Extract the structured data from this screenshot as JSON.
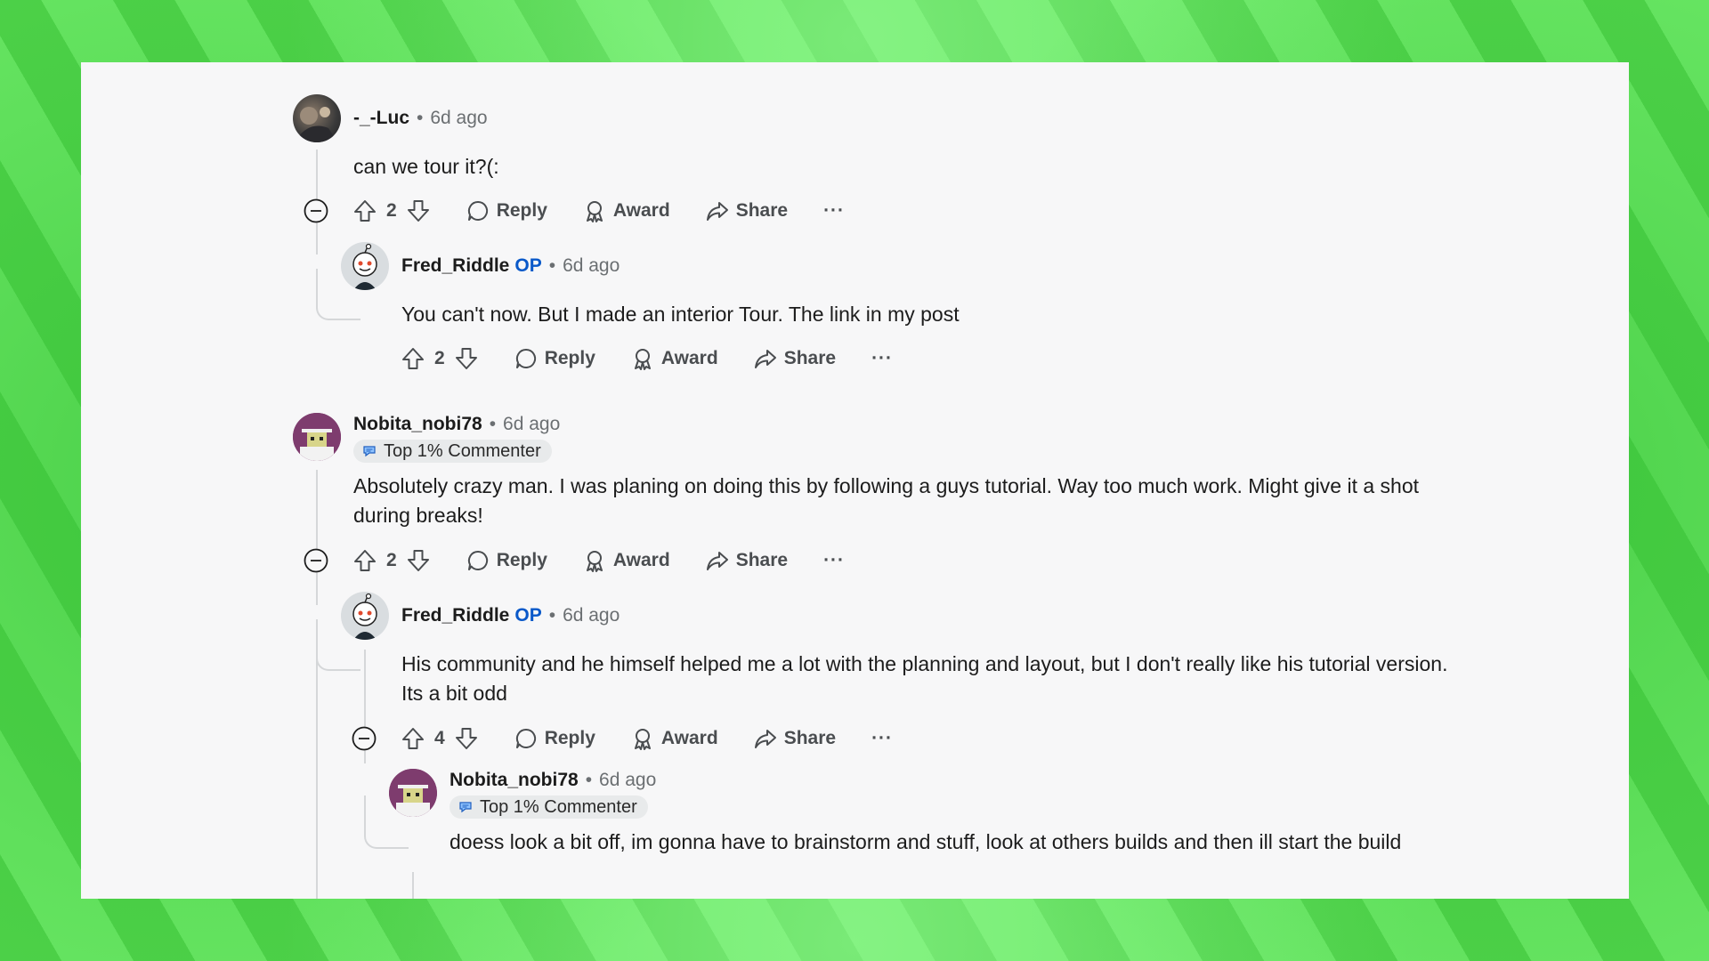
{
  "comments": [
    {
      "user": "-_-Luc",
      "time": "6d ago",
      "body": "can we tour it?(:",
      "votes": "2",
      "reply": "Reply",
      "award": "Award",
      "share": "Share",
      "more": "···"
    },
    {
      "user": "Fred_Riddle",
      "op": "OP",
      "time": "6d ago",
      "body": "You can't now. But I made an interior Tour. The link in my post",
      "votes": "2",
      "reply": "Reply",
      "award": "Award",
      "share": "Share",
      "more": "···"
    },
    {
      "user": "Nobita_nobi78",
      "time": "6d ago",
      "badge": "Top 1% Commenter",
      "body": "Absolutely crazy man. I was planing on doing this by following a guys tutorial. Way too much work. Might give it a shot during breaks!",
      "votes": "2",
      "reply": "Reply",
      "award": "Award",
      "share": "Share",
      "more": "···"
    },
    {
      "user": "Fred_Riddle",
      "op": "OP",
      "time": "6d ago",
      "body": "His community and he himself helped me a lot with the planning and layout, but I don't really like his tutorial version. Its a bit odd",
      "votes": "4",
      "reply": "Reply",
      "award": "Award",
      "share": "Share",
      "more": "···"
    },
    {
      "user": "Nobita_nobi78",
      "time": "6d ago",
      "badge": "Top 1% Commenter",
      "body": "doess look a bit off, im gonna have to brainstorm and stuff, look at others builds and then ill start the build"
    }
  ],
  "colors": {
    "op": "#0a59c9",
    "thread_line": "#d5d7d9",
    "panel": "#f7f7f8"
  }
}
